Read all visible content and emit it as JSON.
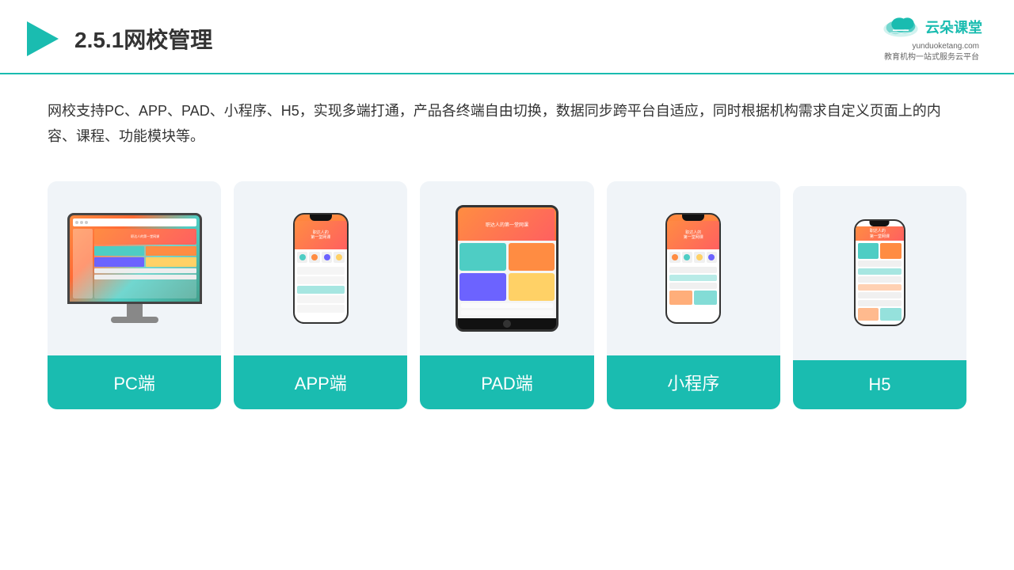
{
  "header": {
    "title": "2.5.1网校管理",
    "logo": {
      "name": "云朵课堂",
      "url_text": "yunduoketang.com",
      "sub_text": "教育机构一站\n式服务云平台"
    }
  },
  "description": "网校支持PC、APP、PAD、小程序、H5，实现多端打通，产品各终端自由切换，数据同步跨平台自适应，同时根据机构需求自定义页面上的内容、课程、功能模块等。",
  "cards": [
    {
      "id": "pc",
      "label": "PC端"
    },
    {
      "id": "app",
      "label": "APP端"
    },
    {
      "id": "pad",
      "label": "PAD端"
    },
    {
      "id": "miniprogram",
      "label": "小程序"
    },
    {
      "id": "h5",
      "label": "H5"
    }
  ]
}
